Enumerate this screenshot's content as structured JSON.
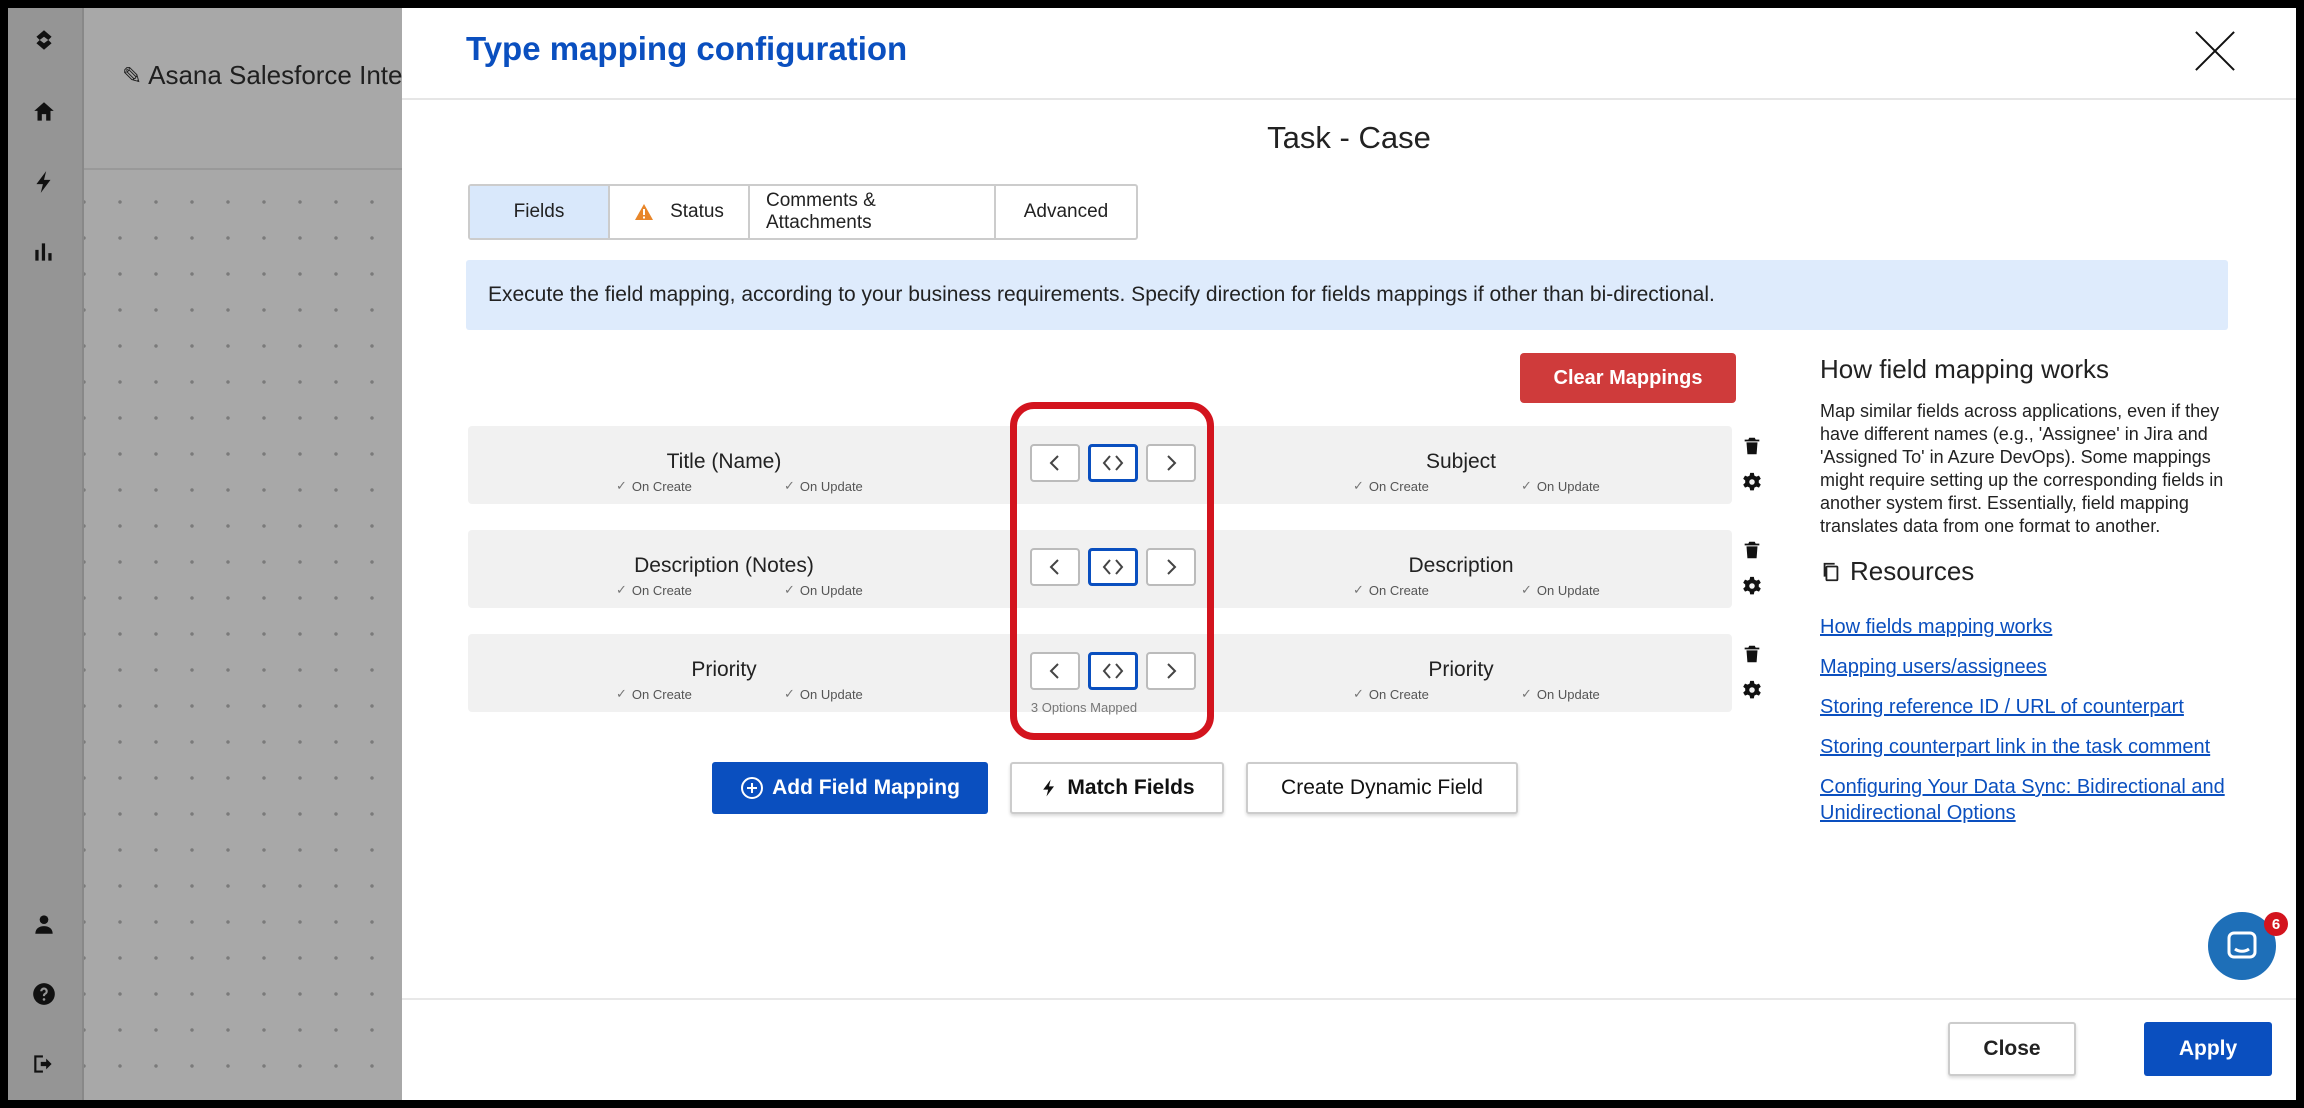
{
  "background_app": {
    "integration_title": "Asana Salesforce Integ"
  },
  "modal": {
    "title": "Type mapping configuration",
    "subtitle": "Task - Case",
    "tabs": [
      {
        "label": "Fields",
        "active": true
      },
      {
        "label": "Status",
        "warning": true
      },
      {
        "label": "Comments & Attachments"
      },
      {
        "label": "Advanced"
      }
    ],
    "info_text": "Execute the field mapping, according to your business requirements. Specify direction for fields mappings if other than bi-directional.",
    "clear_label": "Clear Mappings",
    "rows": [
      {
        "left": "Title (Name)",
        "right": "Subject",
        "flag1": "On Create",
        "flag2": "On Update"
      },
      {
        "left": "Description (Notes)",
        "right": "Description",
        "flag1": "On Create",
        "flag2": "On Update"
      },
      {
        "left": "Priority",
        "right": "Priority",
        "flag1": "On Create",
        "flag2": "On Update",
        "note": "3 Options Mapped"
      }
    ],
    "buttons": {
      "add": "Add Field Mapping",
      "match": "Match Fields",
      "dynamic": "Create Dynamic Field"
    },
    "help": {
      "title": "How field mapping works",
      "text": "Map similar fields across applications, even if they have different names (e.g., 'Assignee' in Jira and 'Assigned To' in Azure DevOps). Some mappings might require setting up the corresponding fields in another system first. Essentially, field mapping translates data from one format to another.",
      "resources_title": "Resources",
      "links": [
        "How fields mapping works",
        "Mapping users/assignees",
        "Storing reference ID / URL of counterpart",
        "Storing counterpart link in the task comment",
        "Configuring Your Data Sync: Bidirectional and Unidirectional Options"
      ]
    },
    "footer": {
      "close": "Close",
      "apply": "Apply"
    }
  },
  "chat": {
    "badge": "6"
  },
  "colors": {
    "accent": "#0a4fbf",
    "danger": "#cf3b3b",
    "highlight": "#d3141e",
    "info_bg": "#deebfc"
  },
  "icons": {
    "rail": [
      "logo-icon",
      "home-icon",
      "bolt-icon",
      "chart-icon",
      "user-icon",
      "help-icon",
      "logout-icon"
    ]
  }
}
